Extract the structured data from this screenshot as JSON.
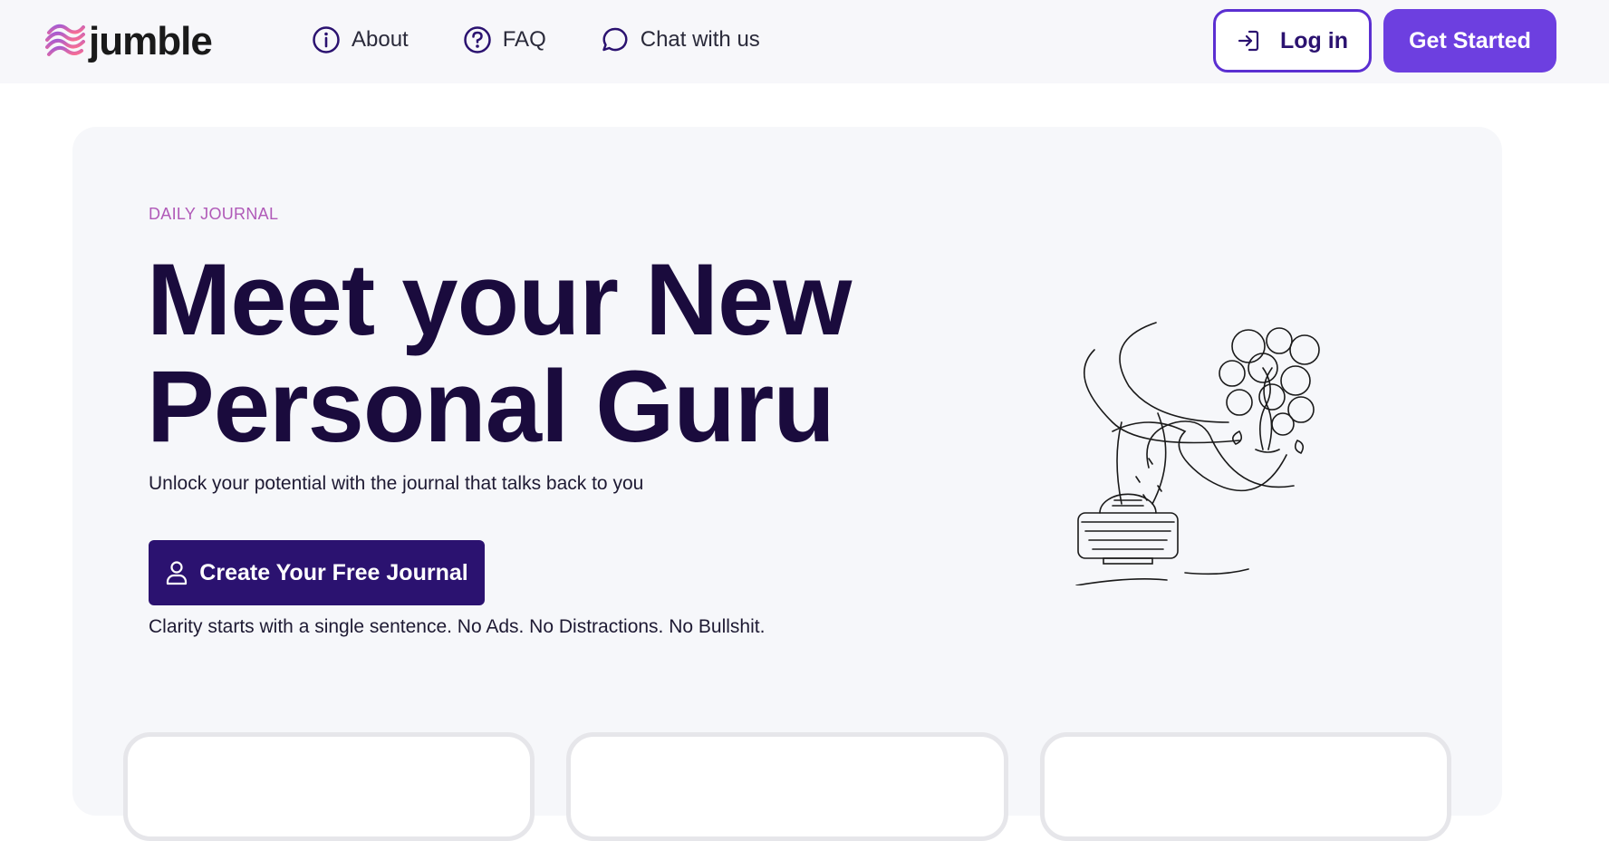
{
  "brand": {
    "name": "jumble"
  },
  "nav": {
    "items": [
      {
        "label": "About",
        "icon": "info-circle-icon"
      },
      {
        "label": "FAQ",
        "icon": "question-circle-icon"
      },
      {
        "label": "Chat with us",
        "icon": "chat-bubble-icon"
      }
    ]
  },
  "header": {
    "login_label": "Log in",
    "get_started_label": "Get Started"
  },
  "hero": {
    "eyebrow": "DAILY JOURNAL",
    "headline_line1": "Meet your New",
    "headline_line2": "Personal Guru",
    "subhead": "Unlock your potential with the journal that talks back to you",
    "cta_label": "Create Your Free Journal",
    "tagline": "Clarity starts with a single sentence. No Ads. No Distractions. No Bullshit.",
    "illustration": "typewriter-tree-illustration"
  },
  "colors": {
    "accent": "#6d3fe0",
    "dark_purple": "#2b1270",
    "headline": "#1a0b3d",
    "eyebrow": "#b05ab8"
  }
}
